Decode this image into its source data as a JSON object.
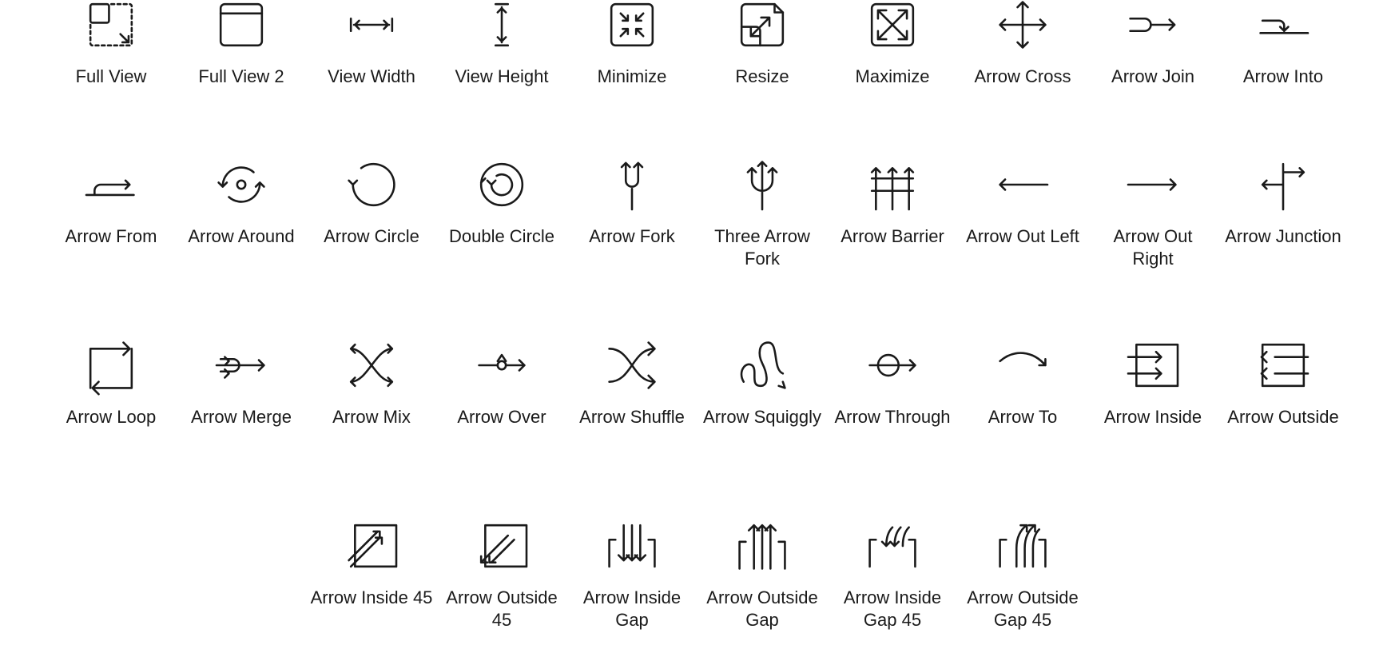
{
  "icons": [
    {
      "label": "Full View",
      "icon": "full-view-icon"
    },
    {
      "label": "Full View 2",
      "icon": "full-view-2-icon"
    },
    {
      "label": "View Width",
      "icon": "view-width-icon"
    },
    {
      "label": "View Height",
      "icon": "view-height-icon"
    },
    {
      "label": "Minimize",
      "icon": "minimize-icon"
    },
    {
      "label": "Resize",
      "icon": "resize-icon"
    },
    {
      "label": "Maximize",
      "icon": "maximize-icon"
    },
    {
      "label": "Arrow Cross",
      "icon": "arrow-cross-icon"
    },
    {
      "label": "Arrow Join",
      "icon": "arrow-join-icon"
    },
    {
      "label": "Arrow Into",
      "icon": "arrow-into-icon"
    },
    {
      "label": "Arrow From",
      "icon": "arrow-from-icon"
    },
    {
      "label": "Arrow Around",
      "icon": "arrow-around-icon"
    },
    {
      "label": "Arrow Circle",
      "icon": "arrow-circle-icon"
    },
    {
      "label": "Double Circle",
      "icon": "double-circle-icon"
    },
    {
      "label": "Arrow Fork",
      "icon": "arrow-fork-icon"
    },
    {
      "label": "Three Arrow Fork",
      "icon": "three-arrow-fork-icon"
    },
    {
      "label": "Arrow Barrier",
      "icon": "arrow-barrier-icon"
    },
    {
      "label": "Arrow Out Left",
      "icon": "arrow-out-left-icon"
    },
    {
      "label": "Arrow Out Right",
      "icon": "arrow-out-right-icon"
    },
    {
      "label": "Arrow Junction",
      "icon": "arrow-junction-icon"
    },
    {
      "label": "Arrow Loop",
      "icon": "arrow-loop-icon"
    },
    {
      "label": "Arrow Merge",
      "icon": "arrow-merge-icon"
    },
    {
      "label": "Arrow Mix",
      "icon": "arrow-mix-icon"
    },
    {
      "label": "Arrow Over",
      "icon": "arrow-over-icon"
    },
    {
      "label": "Arrow Shuffle",
      "icon": "arrow-shuffle-icon"
    },
    {
      "label": "Arrow Squiggly",
      "icon": "arrow-squiggly-icon"
    },
    {
      "label": "Arrow Through",
      "icon": "arrow-through-icon"
    },
    {
      "label": "Arrow To",
      "icon": "arrow-to-icon"
    },
    {
      "label": "Arrow Inside",
      "icon": "arrow-inside-icon"
    },
    {
      "label": "Arrow Outside",
      "icon": "arrow-outside-icon"
    },
    {
      "label": "Arrow Inside 45",
      "icon": "arrow-inside-45-icon"
    },
    {
      "label": "Arrow Outside 45",
      "icon": "arrow-outside-45-icon"
    },
    {
      "label": "Arrow Inside Gap",
      "icon": "arrow-inside-gap-icon"
    },
    {
      "label": "Arrow Outside Gap",
      "icon": "arrow-outside-gap-icon"
    },
    {
      "label": "Arrow Inside Gap 45",
      "icon": "arrow-inside-gap-45-icon"
    },
    {
      "label": "Arrow Outside Gap 45",
      "icon": "arrow-outside-gap-45-icon"
    }
  ]
}
